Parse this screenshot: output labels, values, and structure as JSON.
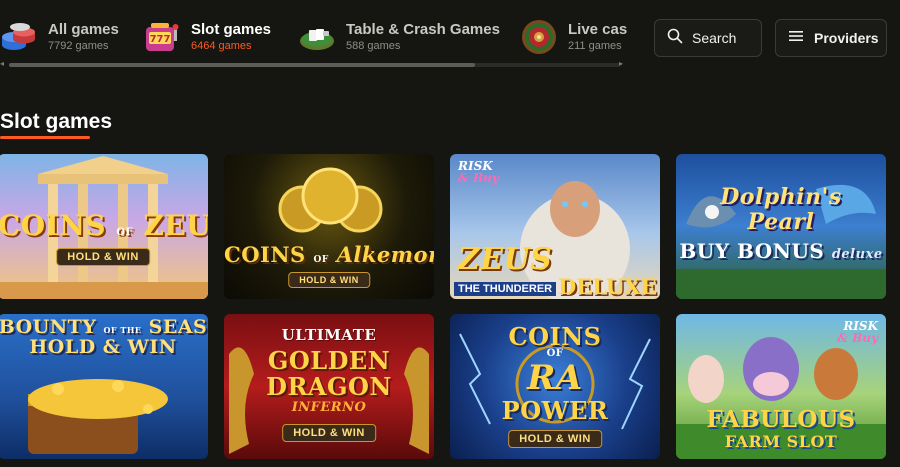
{
  "categories": [
    {
      "name": "All games",
      "count": "7792 games",
      "icon": "chips-stack-icon",
      "active": false
    },
    {
      "name": "Slot games",
      "count": "6464 games",
      "icon": "slot-machine-icon",
      "active": true
    },
    {
      "name": "Table & Crash Games",
      "count": "588 games",
      "icon": "card-table-icon",
      "active": false
    },
    {
      "name": "Live cas",
      "count": "211 games",
      "icon": "roulette-wheel-icon",
      "active": false
    }
  ],
  "search": {
    "label": "Search",
    "icon": "search-icon"
  },
  "providers": {
    "label": "Providers",
    "icon": "menu-icon"
  },
  "section": {
    "title": "Slot games"
  },
  "colors": {
    "accent": "#ff5a1f",
    "background": "#151512"
  },
  "games": [
    {
      "title": "COINS",
      "sub": "ZEUS",
      "of": "OF",
      "badge": "HOLD & WIN"
    },
    {
      "title": "COINS",
      "sub": "Alkemor",
      "of": "OF",
      "badge": "HOLD & WIN"
    },
    {
      "title": "ZEUS",
      "sub": "THE THUNDERER",
      "extra": "DELUXE",
      "corner1": "RISK",
      "corner2": "& Buy"
    },
    {
      "title": "Dolphin's",
      "sub": "Pearl",
      "extra": "BUY BONUS",
      "extra2": "deluxe"
    },
    {
      "title": "BOUNTY",
      "sub": "SEAS",
      "of": "OF THE",
      "badge": "HOLD & WIN"
    },
    {
      "title": "ULTIMATE",
      "sub": "GOLDEN",
      "extra": "DRAGON",
      "extra2": "INFERNO",
      "badge": "HOLD & WIN"
    },
    {
      "title": "COINS",
      "sub": "RA",
      "of": "OF",
      "extra": "POWER",
      "badge": "HOLD & WIN"
    },
    {
      "title": "FABULOUS",
      "sub": "FARM SLOT",
      "corner1": "RISK",
      "corner2": "& Buy"
    }
  ]
}
